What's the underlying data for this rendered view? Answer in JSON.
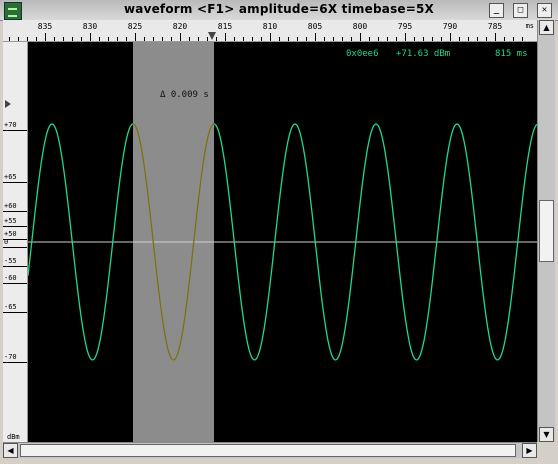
{
  "window": {
    "title": "waveform  <F1> amplitude=6X timebase=5X",
    "buttons": {
      "minimize": "_",
      "maximize": "□",
      "close": "✕"
    }
  },
  "ruler": {
    "labels": [
      "835",
      "830",
      "825",
      "820",
      "815",
      "810",
      "805",
      "800",
      "795",
      "790",
      "785"
    ],
    "unit": "ms"
  },
  "yaxis": {
    "labels": [
      "+70",
      "+65",
      "+60",
      "+55",
      "+50",
      "0",
      "-55",
      "-60",
      "-65",
      "-70"
    ],
    "unit": "dBm"
  },
  "status": {
    "address": "0x0ee6",
    "level": "+71.63 dBm",
    "time": "815 ms"
  },
  "selection": {
    "delta_label": "Δ 0.009 s"
  },
  "colors": {
    "wave": "#1fd98a",
    "wave_selected": "#8a6a10",
    "selection": "#8c8c8c",
    "plot_bg": "#000000",
    "baseline": "#cfcfcf"
  },
  "chart_data": {
    "type": "line",
    "series": [
      {
        "name": "",
        "shape": "sine",
        "cycles_visible": 6.3
      }
    ],
    "ylim": [
      -70,
      70
    ],
    "xlabel": "ms",
    "ylabel": "dBm"
  }
}
